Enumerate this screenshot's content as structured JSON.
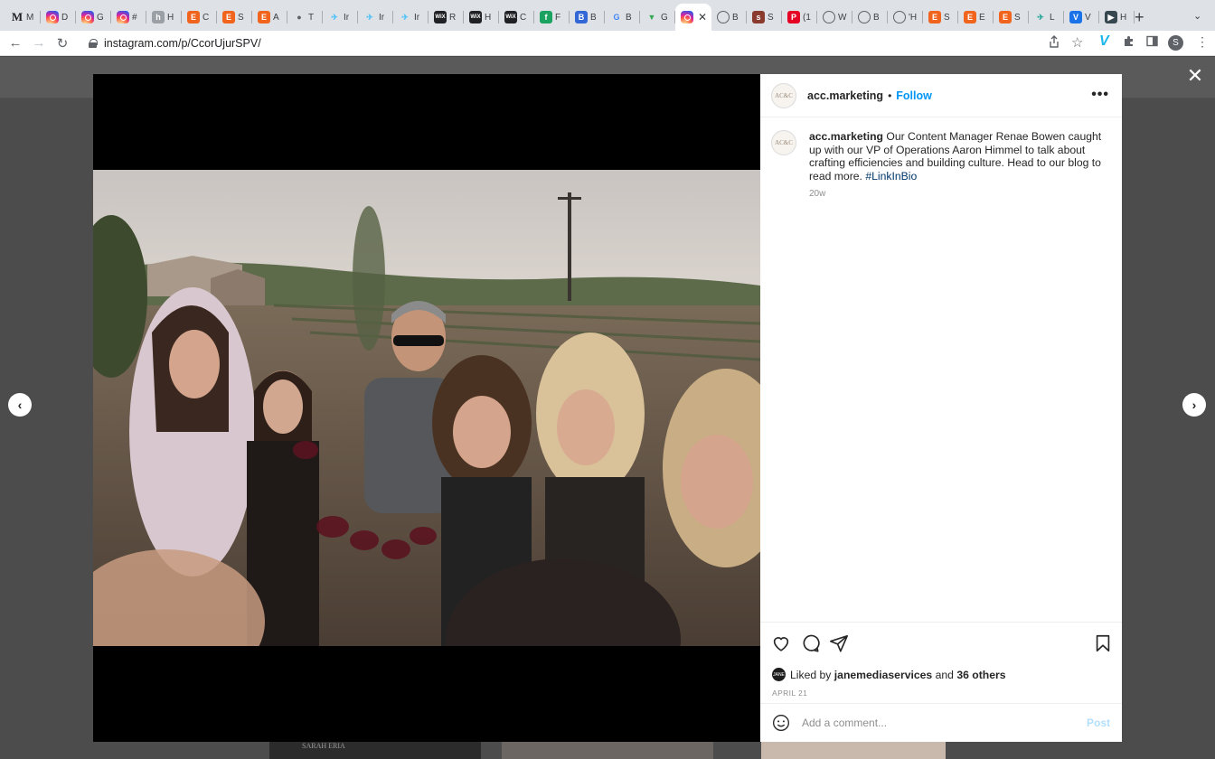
{
  "browser": {
    "tabs": [
      {
        "label": "M",
        "favicon": "M",
        "color": "#ffffff",
        "text": "#202124"
      },
      {
        "label": "D",
        "favicon": "ig",
        "color": "#d6249f"
      },
      {
        "label": "G",
        "favicon": "ig",
        "color": "#d6249f"
      },
      {
        "label": "#",
        "favicon": "ig",
        "color": "#d6249f"
      },
      {
        "label": "H",
        "favicon": "h",
        "color": "#9aa0a6"
      },
      {
        "label": "C",
        "favicon": "E",
        "color": "#f1641e"
      },
      {
        "label": "S",
        "favicon": "E",
        "color": "#f1641e"
      },
      {
        "label": "A",
        "favicon": "E",
        "color": "#f1641e"
      },
      {
        "label": "T",
        "favicon": "globe",
        "color": "#5f6368"
      },
      {
        "label": "Ir",
        "favicon": "bird",
        "color": "#4fc3f7"
      },
      {
        "label": "Ir",
        "favicon": "bird",
        "color": "#4fc3f7"
      },
      {
        "label": "Ir",
        "favicon": "bird",
        "color": "#4fc3f7"
      },
      {
        "label": "R",
        "favicon": "WiX",
        "color": "#202124"
      },
      {
        "label": "H",
        "favicon": "WiX",
        "color": "#202124"
      },
      {
        "label": "C",
        "favicon": "WiX",
        "color": "#202124"
      },
      {
        "label": "F",
        "favicon": "f",
        "color": "#1aa260"
      },
      {
        "label": "B",
        "favicon": "B",
        "color": "#3367d6"
      },
      {
        "label": "B",
        "favicon": "G",
        "color": "#4285f4"
      },
      {
        "label": "G",
        "favicon": "pin",
        "color": "#34a853"
      },
      {
        "label": "",
        "favicon": "ig",
        "color": "#d6249f",
        "active": true
      },
      {
        "label": "B",
        "favicon": "o",
        "color": "#5f6368"
      },
      {
        "label": "S",
        "favicon": "s",
        "color": "#8b3a2e"
      },
      {
        "label": "(1",
        "favicon": "P",
        "color": "#e60023"
      },
      {
        "label": "W",
        "favicon": "o",
        "color": "#5f6368"
      },
      {
        "label": "B",
        "favicon": "o",
        "color": "#5f6368"
      },
      {
        "label": "'H",
        "favicon": "o",
        "color": "#5f6368"
      },
      {
        "label": "S",
        "favicon": "E",
        "color": "#f1641e"
      },
      {
        "label": "E",
        "favicon": "E",
        "color": "#f1641e"
      },
      {
        "label": "S",
        "favicon": "E",
        "color": "#f1641e"
      },
      {
        "label": "L",
        "favicon": "bird",
        "color": "#26a69a"
      },
      {
        "label": "V",
        "favicon": "V",
        "color": "#1a73e8"
      },
      {
        "label": "H",
        "favicon": "tag",
        "color": "#37474f"
      }
    ],
    "url": "instagram.com/p/CcorUjurSPV/",
    "profile_initial": "S",
    "vimeo_ext": "V"
  },
  "background": {
    "card_text": "SARAH ERIA"
  },
  "post": {
    "username": "acc.marketing",
    "avatar_text": "AC&C",
    "follow_label": "Follow",
    "separator": "•",
    "more_label": "•••",
    "caption_user": "acc.marketing",
    "caption_text": " Our Content Manager Renae Bowen caught up with our VP of Operations Aaron Himmel to talk about crafting efficiencies and building culture. Head to our blog to read more. ",
    "hashtag": "#LinkInBio",
    "caption_time": "20w",
    "liked_by_prefix": "Liked by ",
    "liked_by_user": "janemediaservices",
    "liked_by_mid": " and ",
    "liked_by_others": "36 others",
    "liker_avatar_text": "JANE",
    "date": "APRIL 21",
    "comment_placeholder": "Add a comment...",
    "post_button": "Post"
  },
  "colors": {
    "follow": "#0095f6",
    "hashtag": "#00376b",
    "post_disabled": "#b2dffc"
  }
}
